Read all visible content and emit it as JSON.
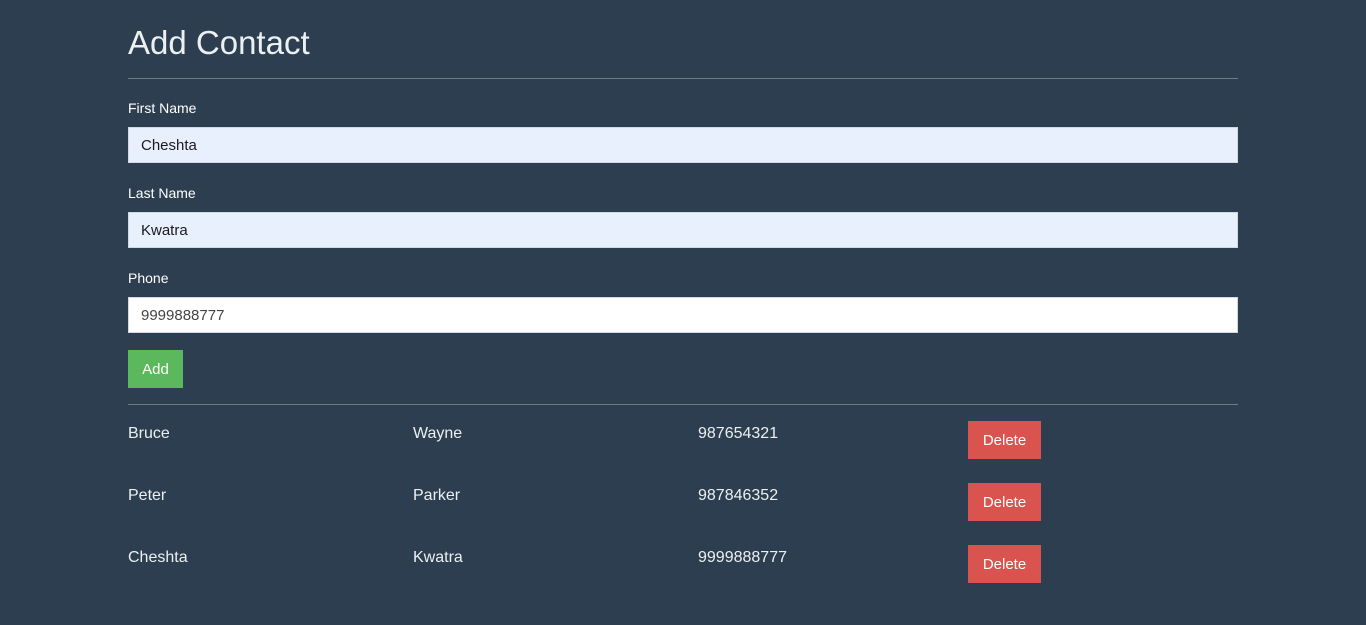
{
  "form": {
    "title": "Add Contact",
    "fields": [
      {
        "label": "First Name",
        "value": "Cheshta"
      },
      {
        "label": "Last Name",
        "value": "Kwatra"
      },
      {
        "label": "Phone",
        "value": "9999888777"
      }
    ],
    "add_label": "Add"
  },
  "contacts": [
    {
      "first": "Bruce",
      "last": "Wayne",
      "phone": "987654321",
      "delete_label": "Delete"
    },
    {
      "first": "Peter",
      "last": "Parker",
      "phone": "987846352",
      "delete_label": "Delete"
    },
    {
      "first": "Cheshta",
      "last": "Kwatra",
      "phone": "9999888777",
      "delete_label": "Delete"
    }
  ],
  "colors": {
    "background": "#2c3e50",
    "add_button": "#5cb85c",
    "delete_button": "#d9534f",
    "autofill": "#e8f0fe"
  }
}
